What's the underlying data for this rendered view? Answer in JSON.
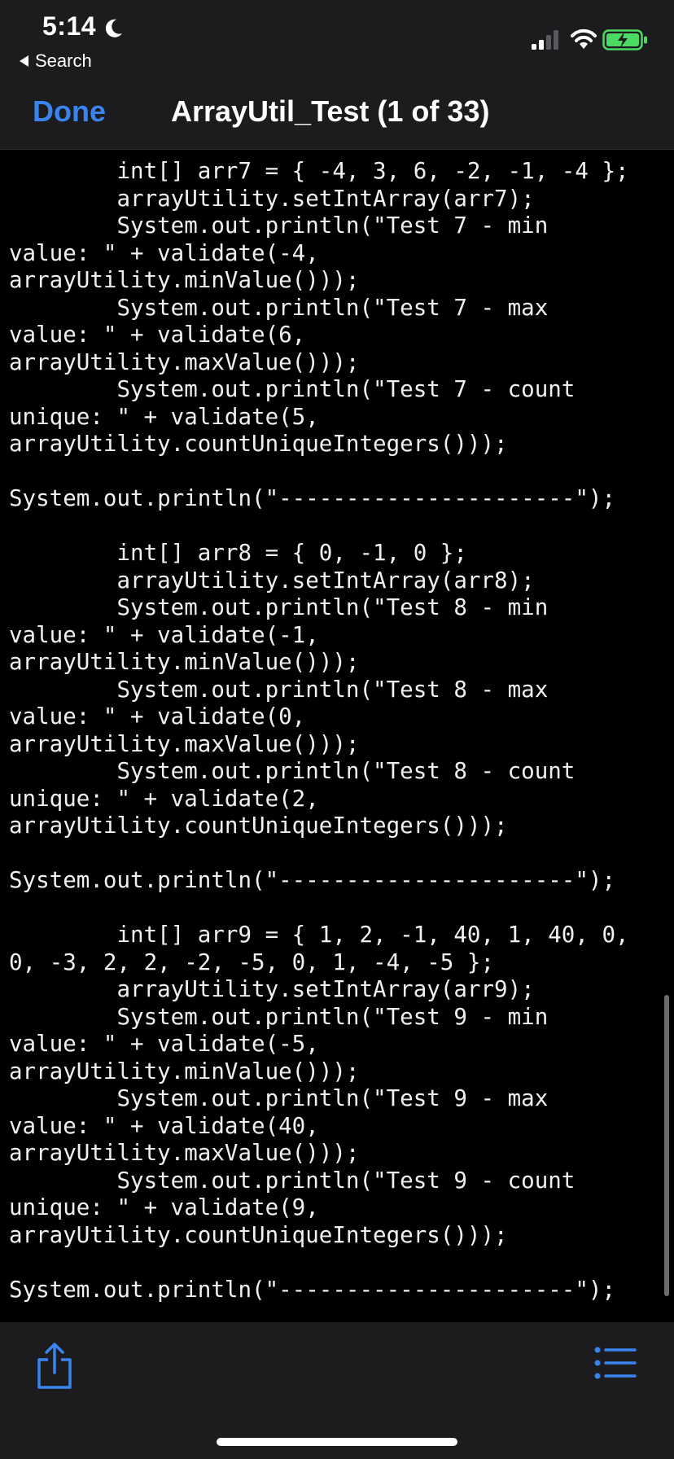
{
  "status_bar": {
    "time": "5:14",
    "back_label": "Search"
  },
  "header": {
    "done_label": "Done",
    "title": "ArrayUtil_Test (1 of 33)"
  },
  "code": {
    "lines": [
      "        int[] arr7 = { -4, 3, 6, -2, -1, -4 };",
      "        arrayUtility.setIntArray(arr7);",
      "        System.out.println(\"Test 7 - min",
      "value: \" + validate(-4,",
      "arrayUtility.minValue()));",
      "        System.out.println(\"Test 7 - max",
      "value: \" + validate(6,",
      "arrayUtility.maxValue()));",
      "        System.out.println(\"Test 7 - count",
      "unique: \" + validate(5,",
      "arrayUtility.countUniqueIntegers()));",
      "",
      "System.out.println(\"----------------------\");",
      "",
      "        int[] arr8 = { 0, -1, 0 };",
      "        arrayUtility.setIntArray(arr8);",
      "        System.out.println(\"Test 8 - min",
      "value: \" + validate(-1,",
      "arrayUtility.minValue()));",
      "        System.out.println(\"Test 8 - max",
      "value: \" + validate(0,",
      "arrayUtility.maxValue()));",
      "        System.out.println(\"Test 8 - count",
      "unique: \" + validate(2,",
      "arrayUtility.countUniqueIntegers()));",
      "",
      "System.out.println(\"----------------------\");",
      "",
      "        int[] arr9 = { 1, 2, -1, 40, 1, 40, 0,",
      "0, -3, 2, 2, -2, -5, 0, 1, -4, -5 };",
      "        arrayUtility.setIntArray(arr9);",
      "        System.out.println(\"Test 9 - min",
      "value: \" + validate(-5,",
      "arrayUtility.minValue()));",
      "        System.out.println(\"Test 9 - max",
      "value: \" + validate(40,",
      "arrayUtility.maxValue()));",
      "        System.out.println(\"Test 9 - count",
      "unique: \" + validate(9,",
      "arrayUtility.countUniqueIntegers()));",
      "",
      "System.out.println(\"----------------------\");"
    ]
  },
  "toolbar": {
    "share_icon": "share-icon",
    "list_icon": "list-icon"
  },
  "colors": {
    "accent": "#3a84f0",
    "bar_background": "#1c1c1e",
    "code_background": "#000000",
    "battery_fill": "#4cd964"
  }
}
